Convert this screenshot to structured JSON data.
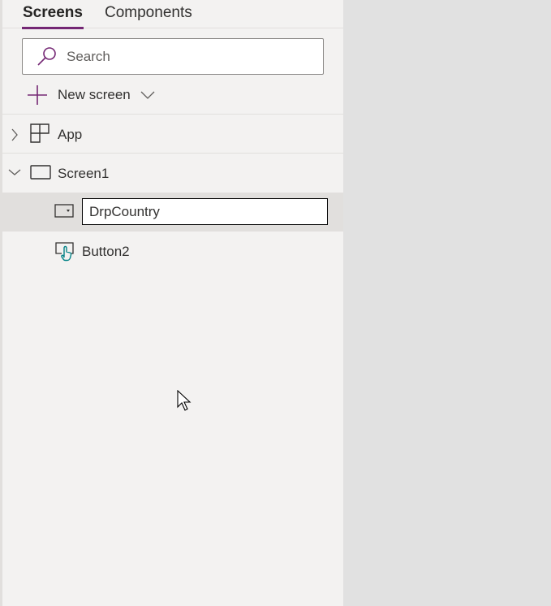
{
  "tabs": [
    {
      "label": "Screens",
      "active": true
    },
    {
      "label": "Components",
      "active": false
    }
  ],
  "search": {
    "placeholder": "Search",
    "value": ""
  },
  "new_screen": {
    "label": "New screen"
  },
  "tree": {
    "app": {
      "label": "App"
    },
    "screen1": {
      "label": "Screen1"
    },
    "dropdown": {
      "label": "DrpCountry"
    },
    "button": {
      "label": "Button2"
    }
  },
  "colors": {
    "accent": "#742774",
    "button_icon": "#038387"
  }
}
